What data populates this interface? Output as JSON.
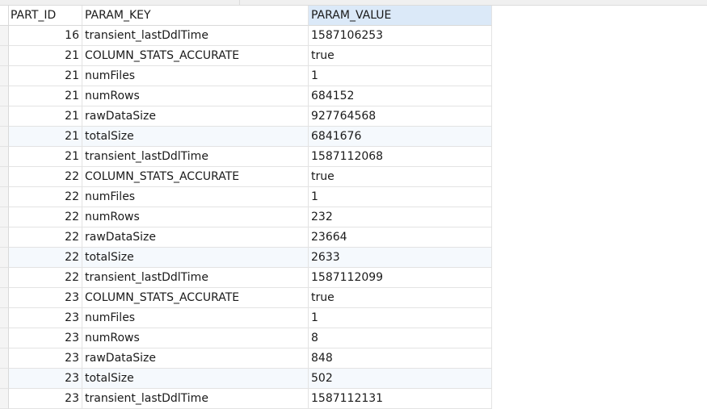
{
  "table": {
    "columns": [
      "PART_ID",
      "PARAM_KEY",
      "PARAM_VALUE"
    ],
    "rows": [
      {
        "part_id": "16",
        "param_key": "transient_lastDdlTime",
        "param_value": "1587106253"
      },
      {
        "part_id": "21",
        "param_key": "COLUMN_STATS_ACCURATE",
        "param_value": "true"
      },
      {
        "part_id": "21",
        "param_key": "numFiles",
        "param_value": "1"
      },
      {
        "part_id": "21",
        "param_key": "numRows",
        "param_value": "684152"
      },
      {
        "part_id": "21",
        "param_key": "rawDataSize",
        "param_value": "927764568"
      },
      {
        "part_id": "21",
        "param_key": "totalSize",
        "param_value": "6841676"
      },
      {
        "part_id": "21",
        "param_key": "transient_lastDdlTime",
        "param_value": "1587112068"
      },
      {
        "part_id": "22",
        "param_key": "COLUMN_STATS_ACCURATE",
        "param_value": "true"
      },
      {
        "part_id": "22",
        "param_key": "numFiles",
        "param_value": "1"
      },
      {
        "part_id": "22",
        "param_key": "numRows",
        "param_value": "232"
      },
      {
        "part_id": "22",
        "param_key": "rawDataSize",
        "param_value": "23664"
      },
      {
        "part_id": "22",
        "param_key": "totalSize",
        "param_value": "2633"
      },
      {
        "part_id": "22",
        "param_key": "transient_lastDdlTime",
        "param_value": "1587112099"
      },
      {
        "part_id": "23",
        "param_key": "COLUMN_STATS_ACCURATE",
        "param_value": "true"
      },
      {
        "part_id": "23",
        "param_key": "numFiles",
        "param_value": "1"
      },
      {
        "part_id": "23",
        "param_key": "numRows",
        "param_value": "8"
      },
      {
        "part_id": "23",
        "param_key": "rawDataSize",
        "param_value": "848"
      },
      {
        "part_id": "23",
        "param_key": "totalSize",
        "param_value": "502"
      },
      {
        "part_id": "23",
        "param_key": "transient_lastDdlTime",
        "param_value": "1587112131"
      }
    ]
  },
  "colors": {
    "selected_header": "#dbe9f8",
    "alt_row": "#f5f9fd",
    "grid_line": "#e3e3e3"
  }
}
